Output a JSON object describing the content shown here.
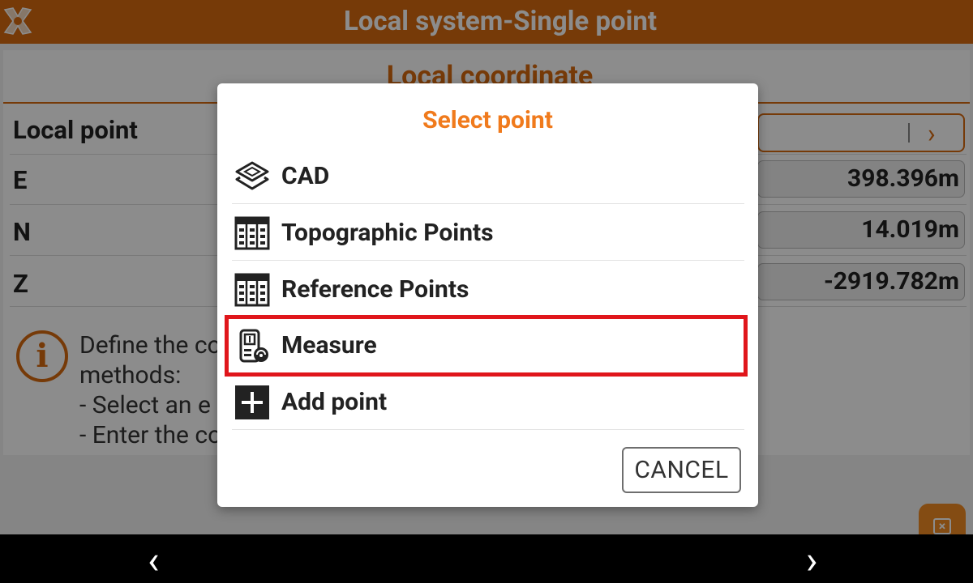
{
  "app": {
    "title": "Local system-Single point",
    "logo_icon": "tool-logo"
  },
  "section": {
    "title": "Local coordinate"
  },
  "fields": {
    "local_point_label": "Local point",
    "e_label": "E",
    "e_value": "398.396m",
    "n_label": "N",
    "n_value": "14.019m",
    "z_label": "Z",
    "z_value": "-2919.782m"
  },
  "info": {
    "icon": "info-icon",
    "text": "Define the co                                                       f the following\nmethods:\n- Select an e\n- Enter the co"
  },
  "dialog": {
    "title": "Select point",
    "options": [
      {
        "label": "CAD",
        "icon": "layers-icon"
      },
      {
        "label": "Topographic Points",
        "icon": "table-icon"
      },
      {
        "label": "Reference Points",
        "icon": "table-icon"
      },
      {
        "label": "Measure",
        "icon": "gnss-receiver-icon"
      },
      {
        "label": "Add point",
        "icon": "plus-icon"
      }
    ],
    "cancel_label": "CANCEL"
  },
  "colors": {
    "brand_orange": "#d86a10",
    "dialog_title_orange": "#f07a1c",
    "highlight_red": "#e0161b"
  }
}
